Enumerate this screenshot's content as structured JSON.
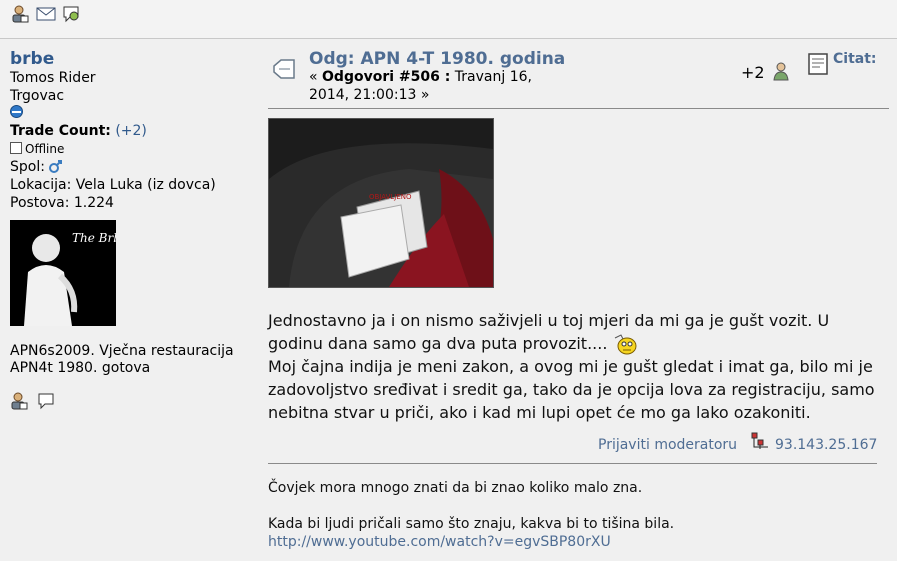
{
  "poster": {
    "username": "brbe",
    "title": "Tomos Rider",
    "position": "Trgovac",
    "trade_count_label": "Trade Count:",
    "trade_count_value": "(+2)",
    "status": "Offline",
    "gender_label": "Spol:",
    "location": "Lokacija: Vela Luka (iz dovca)",
    "posts": "Postova: 1.224",
    "avatar_text": "The Brbe",
    "bio_line1": "APN6s2009. Vječna restauracija",
    "bio_line2": "APN4t 1980. gotova"
  },
  "post": {
    "subject": "Odg: APN 4-T 1980. godina",
    "reply_prefix": "«",
    "reply_label": "Odgovori #506 :",
    "reply_date": "Travanj 16, 2014, 21:00:13 »",
    "karma": "+2",
    "quote_label": "Citat:",
    "photo_label": "OBJAVLJENO",
    "body_line1": "Jednostavno ja i on nismo saživjeli u toj mjeri da mi ga je gušt vozit. U godinu dana samo ga dva puta provozit....",
    "body_line2": "Moj čajna indija je meni zakon, a ovog mi je gušt gledat i imat ga, bilo mi je zadovoljstvo sređivat i sredit ga, tako da je opcija lova za registraciju, samo nebitna stvar u priči, ako i kad mi lupi opet će mo ga lako ozakoniti.",
    "report_label": "Prijaviti moderatoru",
    "ip": "93.143.25.167"
  },
  "signature": {
    "line1": "Čovjek mora mnogo znati da bi znao koliko malo zna.",
    "line2": "Kada bi ljudi pričali samo što znaju, kakva bi to tišina bila.",
    "link": "http://www.youtube.com/watch?v=egvSBP80rXU"
  },
  "icons": {
    "top": [
      "profile-icon",
      "email-icon",
      "pm-icon"
    ],
    "left": [
      "profile-icon",
      "pm-icon"
    ],
    "post": "post-icon",
    "karma": "karma-user-icon",
    "quote": "quote-icon",
    "ip": "ip-icon",
    "smiley": "rolling-eyes-icon"
  },
  "colors": {
    "link": "#4f6d93",
    "username": "#315a8c",
    "background": "#f0f0f0"
  }
}
